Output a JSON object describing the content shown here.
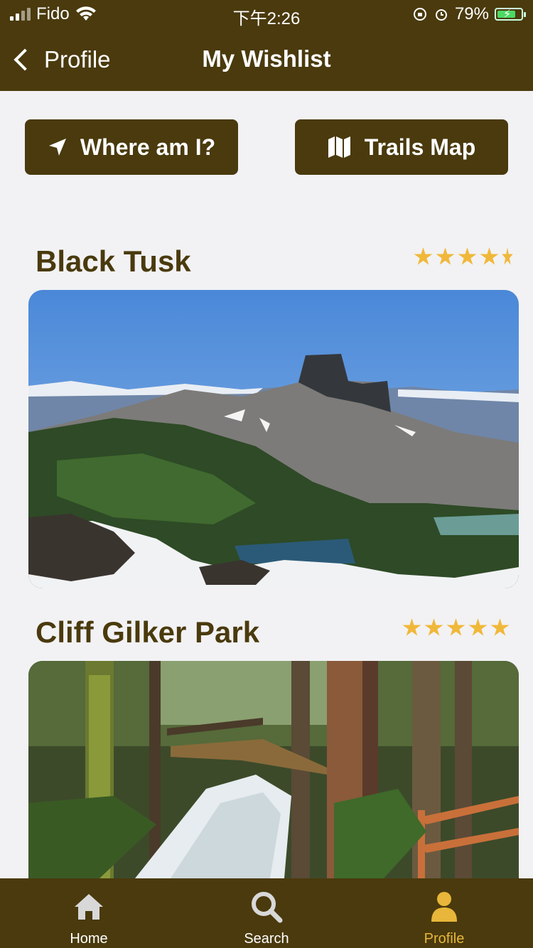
{
  "status_bar": {
    "carrier": "Fido",
    "time": "下午2:26",
    "battery_percent": "79%"
  },
  "nav": {
    "back_label": "Profile",
    "title": "My Wishlist"
  },
  "actions": {
    "where_label": "Where am I?",
    "map_label": "Trails Map"
  },
  "trails": [
    {
      "name": "Black Tusk",
      "rating": 4.5
    },
    {
      "name": "Cliff Gilker Park",
      "rating": 5
    }
  ],
  "tabbar": {
    "items": [
      {
        "label": "Home",
        "icon": "home-icon",
        "active": false
      },
      {
        "label": "Search",
        "icon": "search-icon",
        "active": false
      },
      {
        "label": "Profile",
        "icon": "person-icon",
        "active": true
      }
    ]
  },
  "colors": {
    "brand": "#4a3a0d",
    "accent": "#e8b63a",
    "star": "#f0b83a",
    "background": "#f2f2f4"
  }
}
